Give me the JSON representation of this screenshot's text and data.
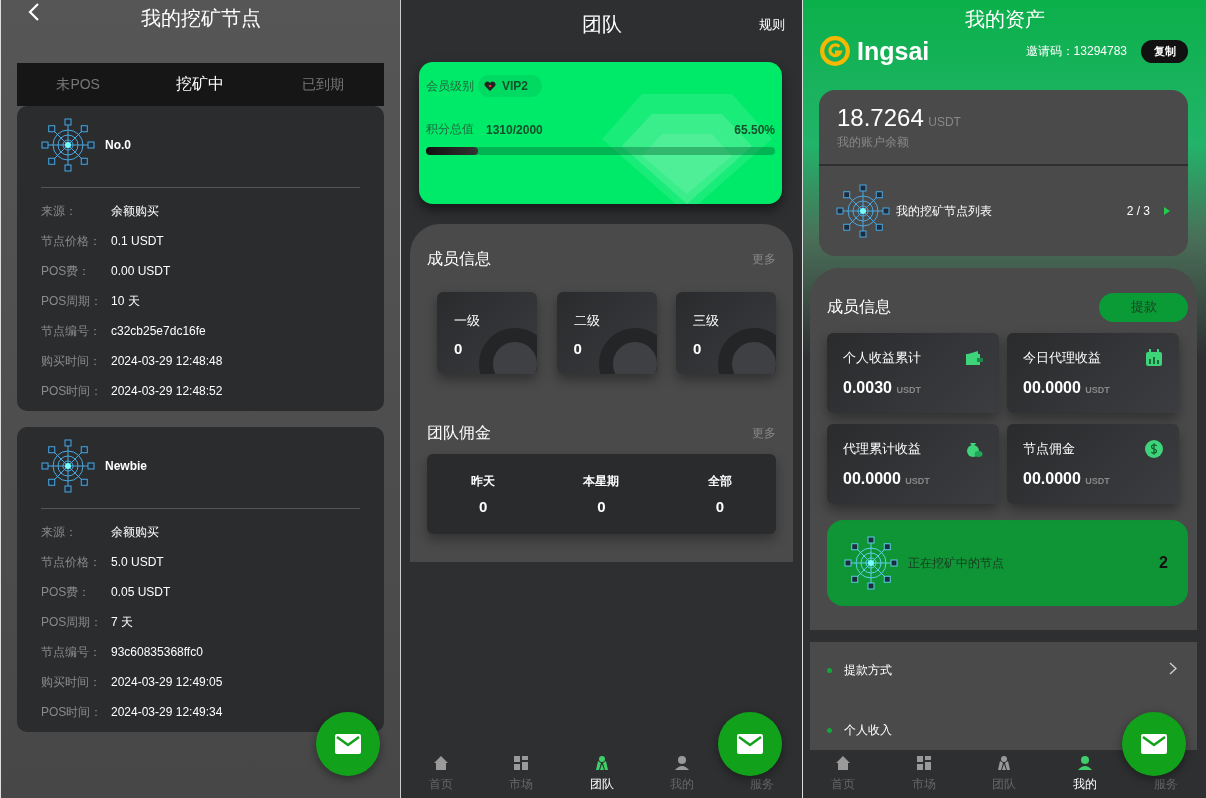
{
  "nodes_screen": {
    "title": "我的挖矿节点",
    "tabs": [
      {
        "label": "未POS",
        "selected": false
      },
      {
        "label": "挖矿中",
        "selected": true
      },
      {
        "label": "已到期",
        "selected": false
      }
    ],
    "nodes": [
      {
        "name": "No.0",
        "fields": [
          {
            "label": "来源：",
            "value": "余额购买"
          },
          {
            "label": "节点价格：",
            "value": "0.1 USDT"
          },
          {
            "label": "POS费：",
            "value": "0.00 USDT"
          },
          {
            "label": "POS周期：",
            "value": "10 天"
          },
          {
            "label": "节点编号：",
            "value": "c32cb25e7dc16fe"
          },
          {
            "label": "购买时间：",
            "value": "2024-03-29 12:48:48"
          },
          {
            "label": "POS时间：",
            "value": "2024-03-29 12:48:52"
          }
        ]
      },
      {
        "name": "Newbie",
        "fields": [
          {
            "label": "来源：",
            "value": "余额购买"
          },
          {
            "label": "节点价格：",
            "value": "5.0 USDT"
          },
          {
            "label": "POS费：",
            "value": "0.05 USDT"
          },
          {
            "label": "POS周期：",
            "value": "7 天"
          },
          {
            "label": "节点编号：",
            "value": "93c60835368ffc0"
          },
          {
            "label": "购买时间：",
            "value": "2024-03-29 12:49:05"
          },
          {
            "label": "POS时间：",
            "value": "2024-03-29 12:49:34"
          }
        ]
      }
    ]
  },
  "team_screen": {
    "title": "团队",
    "rules_link": "规则",
    "vip": {
      "label": "会员级别",
      "badge": "VIP2",
      "points_label": "积分总值",
      "points": "1310/2000",
      "percent": "65.50%",
      "level": 0.15
    },
    "members": {
      "title": "成员信息",
      "more": "更多",
      "tiers": [
        {
          "label": "一级",
          "count": "0"
        },
        {
          "label": "二级",
          "count": "0"
        },
        {
          "label": "三级",
          "count": "0"
        }
      ]
    },
    "commission": {
      "title": "团队佣金",
      "more": "更多",
      "periods": [
        {
          "label": "昨天",
          "value": "0"
        },
        {
          "label": "本星期",
          "value": "0"
        },
        {
          "label": "全部",
          "value": "0"
        }
      ]
    },
    "nav": [
      {
        "kind": "home",
        "label": "首页",
        "selected": false
      },
      {
        "kind": "market",
        "label": "市场",
        "selected": false
      },
      {
        "kind": "team",
        "label": "团队",
        "selected": true
      },
      {
        "kind": "me",
        "label": "我的",
        "selected": false
      },
      {
        "kind": "service",
        "label": "服务",
        "selected": false
      }
    ]
  },
  "assets_screen": {
    "title": "我的资产",
    "brand": "Ingsai",
    "invite_label": "邀请码：",
    "invite_code": "13294783",
    "copy_button": "复制",
    "balance": "18.7264",
    "balance_unit": "USDT",
    "balance_label": "我的账户余额",
    "node_list_label": "我的挖矿节点列表",
    "node_count": "2 / 3",
    "members_title": "成员信息",
    "withdraw_button": "提款",
    "stats": [
      {
        "kind": "wallet",
        "label": "个人收益累计",
        "value": "0.0030",
        "unit": "USDT"
      },
      {
        "kind": "calendar",
        "label": "今日代理收益",
        "value": "00.0000",
        "unit": "USDT"
      },
      {
        "kind": "money-bag",
        "label": "代理累计收益",
        "value": "00.0000",
        "unit": "USDT"
      },
      {
        "kind": "coin",
        "label": "节点佣金",
        "value": "00.0000",
        "unit": "USDT"
      }
    ],
    "mining": {
      "label": "正在挖矿中的节点",
      "count": "2"
    },
    "menu": [
      {
        "label": "提款方式"
      },
      {
        "label": "个人收入"
      }
    ],
    "nav": [
      {
        "kind": "home",
        "label": "首页",
        "selected": false
      },
      {
        "kind": "market",
        "label": "市场",
        "selected": false
      },
      {
        "kind": "team",
        "label": "团队",
        "selected": false
      },
      {
        "kind": "me",
        "label": "我的",
        "selected": true
      },
      {
        "kind": "service",
        "label": "服务",
        "selected": false
      }
    ]
  }
}
